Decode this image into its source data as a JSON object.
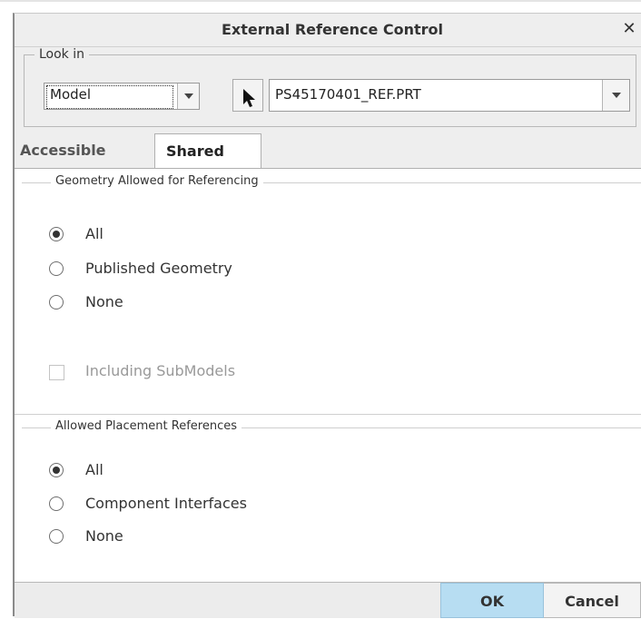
{
  "window": {
    "title": "External Reference Control",
    "close_glyph": "✕"
  },
  "look_in": {
    "legend": "Look in",
    "model_type": "Model",
    "model_name": "PS45170401_REF.PRT"
  },
  "tabs": [
    {
      "label": "Accessible",
      "active": false
    },
    {
      "label": "Shared",
      "active": true
    }
  ],
  "geometry_group": {
    "legend": "Geometry Allowed for Referencing",
    "options": [
      {
        "label": "All",
        "checked": true
      },
      {
        "label": "Published Geometry",
        "checked": false
      },
      {
        "label": "None",
        "checked": false
      }
    ],
    "include_submodels": {
      "label": "Including SubModels",
      "checked": false,
      "enabled": false
    }
  },
  "placement_group": {
    "legend": "Allowed Placement References",
    "options": [
      {
        "label": "All",
        "checked": true
      },
      {
        "label": "Component Interfaces",
        "checked": false
      },
      {
        "label": "None",
        "checked": false
      }
    ]
  },
  "footer": {
    "ok_label": "OK",
    "cancel_label": "Cancel"
  }
}
